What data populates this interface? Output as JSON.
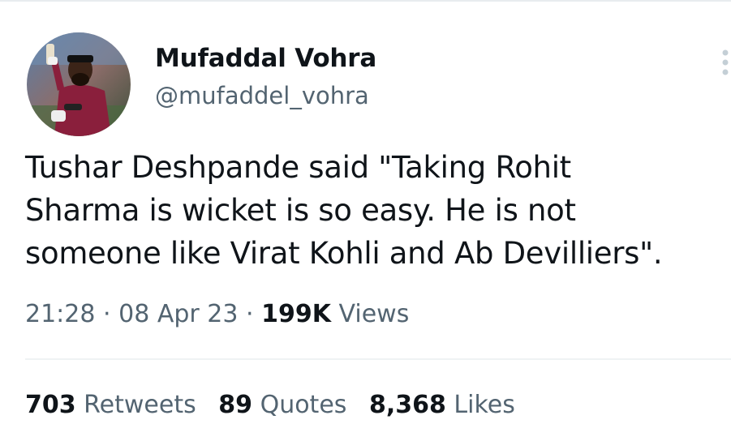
{
  "author": {
    "display_name": "Mufaddal Vohra",
    "handle": "@mufaddel_vohra",
    "avatar_icon": "profile-photo"
  },
  "tweet": {
    "text_lines": [
      "Tushar Deshpande said \"Taking Rohit",
      "Sharma is wicket is so easy. He is not",
      "someone like Virat Kohli and Ab Devilliers\"."
    ]
  },
  "meta": {
    "time": "21:28",
    "separator": "·",
    "date": "08 Apr 23",
    "views_count": "199K",
    "views_label": "Views"
  },
  "stats": {
    "retweets_count": "703",
    "retweets_label": "Retweets",
    "quotes_count": "89",
    "quotes_label": "Quotes",
    "likes_count": "8,368",
    "likes_label": "Likes"
  },
  "colors": {
    "text_primary": "#0f1419",
    "text_secondary": "#536471",
    "divider": "#eff3f4"
  }
}
